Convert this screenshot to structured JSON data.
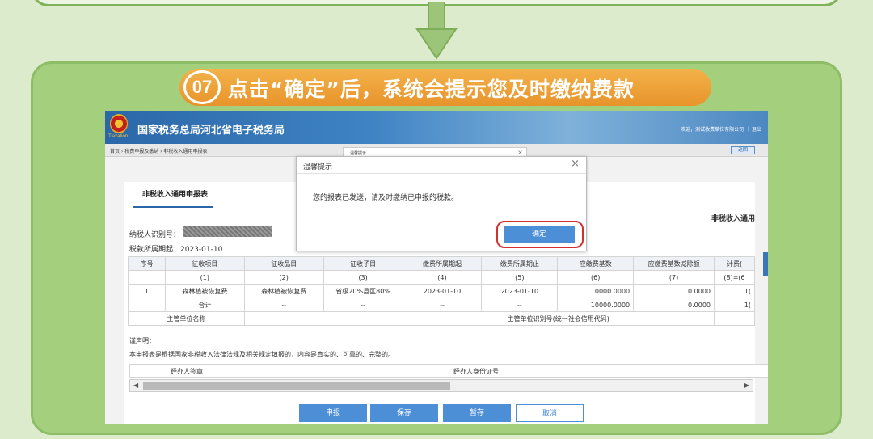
{
  "slide": {
    "step_number": "07",
    "step_title": "点击“确定”后，系统会提示您及时缴纳费款"
  },
  "header": {
    "emblem_sub": "Tiaxation",
    "site_title": "国家税务总局河北省电子税务局",
    "user_info": "欢迎，测试收费单位有限公司 ｜ 退出"
  },
  "nav": {
    "breadcrumb": "首页 › 税费申报及缴纳 › 非税收入通用申报表",
    "back_label": "返回"
  },
  "form": {
    "tab_label": "非税收入通用申报表",
    "right_title": "非税收入通用",
    "taxpayer_label": "纳税人识别号：",
    "period_label": "税款所属期起：2023-01-10",
    "declaration_label": "谨声明：",
    "declaration_text": "本申报表是根据国家非税收入法律法规及相关规定填报的，内容是真实的、可靠的、完整的。",
    "signer_label": "经办人签章",
    "signer_id_label": "经办人身份证号"
  },
  "table": {
    "headers": [
      "序号",
      "征收项目",
      "征收品目",
      "征收子目",
      "缴费所属期起",
      "缴费所属期止",
      "应缴费基数",
      "应缴费基数减除额",
      "计费("
    ],
    "indices": [
      "",
      "(1)",
      "(2)",
      "(3)",
      "(4)",
      "(5)",
      "(6)",
      "(7)",
      "(8)=(6"
    ],
    "row1": [
      "1",
      "森林植被恢复费",
      "森林植被恢复费",
      "省级20%县区80%",
      "2023-01-10",
      "2023-01-10",
      "10000.0000",
      "0.0000",
      "1("
    ],
    "total": [
      "",
      "合计",
      "--",
      "--",
      "--",
      "--",
      "10000.0000",
      "0.0000",
      "1("
    ],
    "unit_name_label": "主管单位名称",
    "unit_code_label": "主管单位识别号(统一社会信用代码)"
  },
  "buttons": {
    "submit": "申报",
    "save": "保存",
    "draft": "暂存",
    "cancel": "取消"
  },
  "dialog_behind": {
    "title": "温馨提示",
    "close": "×"
  },
  "dialog": {
    "title": "温馨提示",
    "close": "×",
    "message": "您的报表已发送，请及时缴纳已申报的税款。",
    "ok_label": "确定"
  },
  "scroll": {
    "left_arrow": "◀",
    "right_arrow": "▶"
  },
  "colors": {
    "background": "#dcebcc",
    "card": "#a4cf7d",
    "pill": "#e7942a",
    "primary": "#4c8fd6",
    "highlight": "#d32f2f"
  }
}
